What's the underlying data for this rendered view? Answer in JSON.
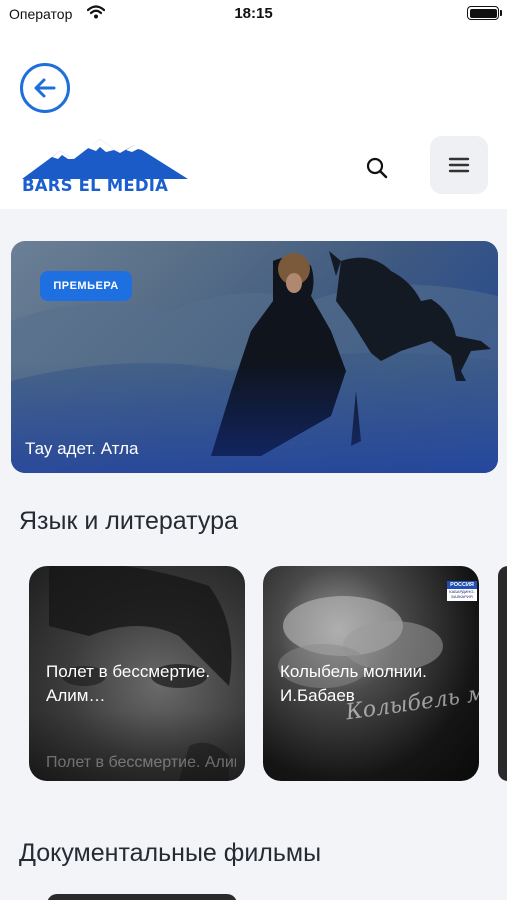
{
  "status_bar": {
    "carrier": "Оператор",
    "time": "18:15"
  },
  "header": {
    "logo_text": "BARS EL MEDIA",
    "accent_color": "#1e6fd9"
  },
  "icons": {
    "back": "arrow-left-circle-icon",
    "search": "search-icon",
    "menu": "hamburger-menu-icon"
  },
  "hero": {
    "badge": "ПРЕМЬЕРА",
    "title": "Тау адет. Атла"
  },
  "sections": [
    {
      "title": "Язык и литература",
      "cards": [
        {
          "title": "Полет в бессмертие. Алим…",
          "subtitle": "Полет в бессмертие. Алим Байсултанов"
        },
        {
          "title": "Колыбель молнии. И.Бабаев",
          "overlay_text": "Колыбель молнии",
          "channel_badge_top": "РОССИЯ",
          "channel_badge_bottom": "КАБАРДИНО-БАЛКАРИЯ"
        }
      ]
    },
    {
      "title": "Документальные фильмы"
    }
  ]
}
